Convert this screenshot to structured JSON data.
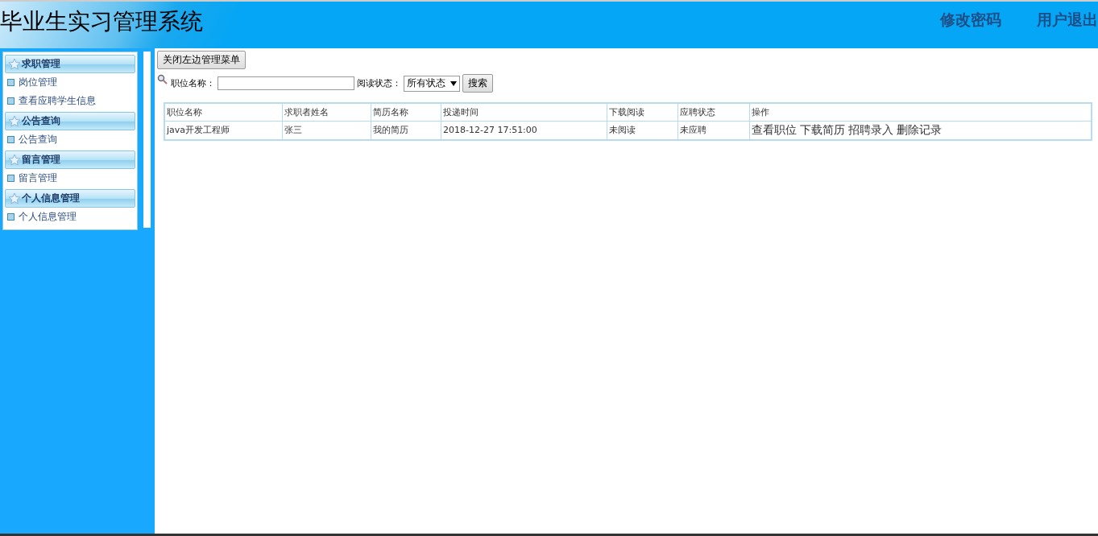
{
  "header": {
    "title": "毕业生实习管理系统",
    "links": [
      "修改密码",
      "用户退出"
    ]
  },
  "sidebar": {
    "sections": [
      {
        "title": "求职管理",
        "items": [
          "岗位管理",
          "查看应聘学生信息"
        ]
      },
      {
        "title": "公告查询",
        "items": [
          "公告查询"
        ]
      },
      {
        "title": "留言管理",
        "items": [
          "留言管理"
        ]
      },
      {
        "title": "个人信息管理",
        "items": [
          "个人信息管理"
        ]
      }
    ]
  },
  "toolbar": {
    "toggle_button": "关闭左边管理菜单"
  },
  "search": {
    "name_label": "职位名称：",
    "status_label": "阅读状态：",
    "status_value": "所有状态",
    "button": "搜索"
  },
  "table": {
    "columns": [
      "职位名称",
      "求职者姓名",
      "简历名称",
      "投递时间",
      "下载阅读",
      "应聘状态",
      "操作"
    ],
    "rows": [
      {
        "cells": [
          "java开发工程师",
          "张三",
          "我的简历",
          "2018-12-27 17:51:00",
          "未阅读",
          "未应聘"
        ],
        "actions": [
          "查看职位",
          "下载简历",
          "招聘录入",
          "删除记录"
        ]
      }
    ]
  }
}
